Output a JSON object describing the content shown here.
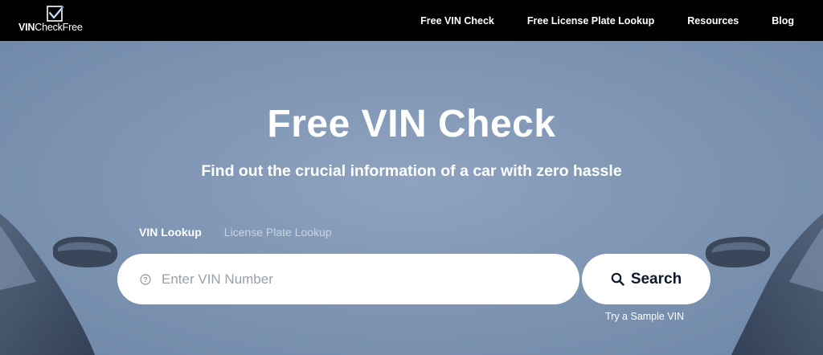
{
  "header": {
    "logo": {
      "brand_bold": "VIN",
      "brand_regular": "CheckFree"
    },
    "nav": [
      {
        "label": "Free VIN Check"
      },
      {
        "label": "Free License Plate Lookup"
      },
      {
        "label": "Resources"
      },
      {
        "label": "Blog"
      }
    ]
  },
  "hero": {
    "title": "Free VIN Check",
    "subtitle": "Find out the crucial information of a car with zero hassle"
  },
  "search": {
    "tabs": [
      {
        "label": "VIN Lookup",
        "active": true
      },
      {
        "label": "License Plate Lookup",
        "active": false
      }
    ],
    "placeholder": "Enter VIN Number",
    "help_icon": "question-circle-icon",
    "button_label": "Search",
    "button_icon": "search-icon",
    "sample_link": "Try a Sample VIN"
  },
  "colors": {
    "header_bg": "#000000",
    "hero_bg": "#8299b7",
    "button_text": "#0c1a2b",
    "placeholder": "#9aa0a8"
  }
}
